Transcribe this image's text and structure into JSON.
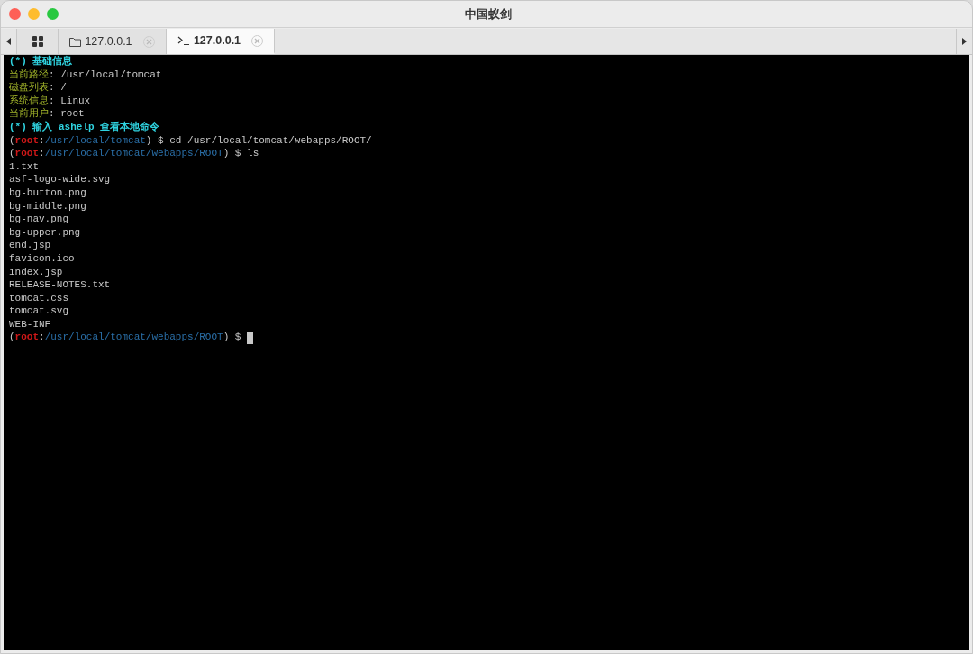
{
  "window": {
    "title": "中国蚁剑"
  },
  "tabs": [
    {
      "kind": "home",
      "selected": false,
      "closable": false
    },
    {
      "kind": "folder",
      "label": "127.0.0.1",
      "selected": false,
      "closable": true
    },
    {
      "kind": "terminal",
      "label": "127.0.0.1",
      "selected": true,
      "closable": true
    }
  ],
  "terminal": {
    "lines": [
      {
        "segments": [
          {
            "kind": "header",
            "text": "(*) 基础信息"
          }
        ]
      },
      {
        "segments": [
          {
            "kind": "label",
            "text": "当前路径"
          },
          {
            "kind": "value",
            "text": ": /usr/local/tomcat"
          }
        ]
      },
      {
        "segments": [
          {
            "kind": "label",
            "text": "磁盘列表"
          },
          {
            "kind": "value",
            "text": ": /"
          }
        ]
      },
      {
        "segments": [
          {
            "kind": "label",
            "text": "系统信息"
          },
          {
            "kind": "value",
            "text": ": Linux"
          }
        ]
      },
      {
        "segments": [
          {
            "kind": "label",
            "text": "当前用户"
          },
          {
            "kind": "value",
            "text": ": root"
          }
        ]
      },
      {
        "segments": [
          {
            "kind": "header",
            "text": "(*) 输入 ashelp 查看本地命令"
          }
        ]
      },
      {
        "segments": [
          {
            "kind": "value",
            "text": "("
          },
          {
            "kind": "user",
            "text": "root"
          },
          {
            "kind": "value",
            "text": ":"
          },
          {
            "kind": "path",
            "text": "/usr/local/tomcat"
          },
          {
            "kind": "value",
            "text": ") $ cd /usr/local/tomcat/webapps/ROOT/"
          }
        ]
      },
      {
        "segments": [
          {
            "kind": "value",
            "text": "("
          },
          {
            "kind": "user",
            "text": "root"
          },
          {
            "kind": "value",
            "text": ":"
          },
          {
            "kind": "path",
            "text": "/usr/local/tomcat/webapps/ROOT"
          },
          {
            "kind": "value",
            "text": ") $ ls"
          }
        ]
      },
      {
        "segments": [
          {
            "kind": "value",
            "text": "1.txt"
          }
        ]
      },
      {
        "segments": [
          {
            "kind": "value",
            "text": "asf-logo-wide.svg"
          }
        ]
      },
      {
        "segments": [
          {
            "kind": "value",
            "text": "bg-button.png"
          }
        ]
      },
      {
        "segments": [
          {
            "kind": "value",
            "text": "bg-middle.png"
          }
        ]
      },
      {
        "segments": [
          {
            "kind": "value",
            "text": "bg-nav.png"
          }
        ]
      },
      {
        "segments": [
          {
            "kind": "value",
            "text": "bg-upper.png"
          }
        ]
      },
      {
        "segments": [
          {
            "kind": "value",
            "text": "end.jsp"
          }
        ]
      },
      {
        "segments": [
          {
            "kind": "value",
            "text": "favicon.ico"
          }
        ]
      },
      {
        "segments": [
          {
            "kind": "value",
            "text": "index.jsp"
          }
        ]
      },
      {
        "segments": [
          {
            "kind": "value",
            "text": "RELEASE-NOTES.txt"
          }
        ]
      },
      {
        "segments": [
          {
            "kind": "value",
            "text": "tomcat.css"
          }
        ]
      },
      {
        "segments": [
          {
            "kind": "value",
            "text": "tomcat.svg"
          }
        ]
      },
      {
        "segments": [
          {
            "kind": "value",
            "text": "WEB-INF"
          }
        ]
      },
      {
        "segments": [
          {
            "kind": "value",
            "text": "("
          },
          {
            "kind": "user",
            "text": "root"
          },
          {
            "kind": "value",
            "text": ":"
          },
          {
            "kind": "path",
            "text": "/usr/local/tomcat/webapps/ROOT"
          },
          {
            "kind": "value",
            "text": ") $"
          }
        ],
        "cursor": true
      }
    ]
  }
}
